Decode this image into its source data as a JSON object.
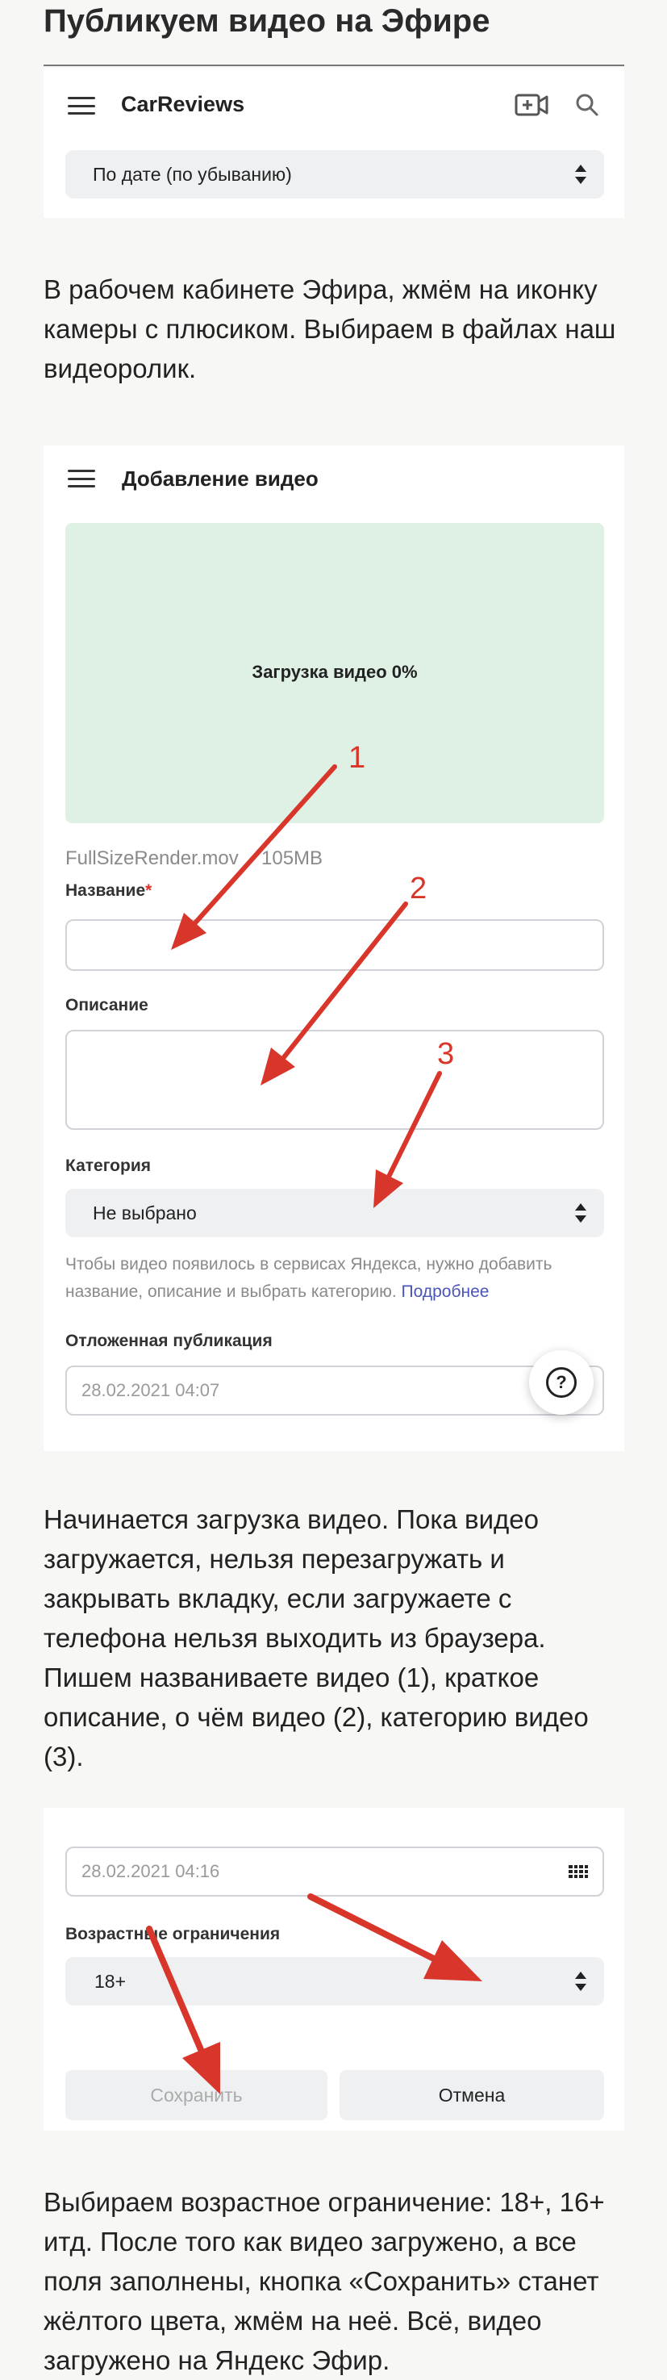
{
  "heading": "Публикуем видео на Эфире",
  "screen1": {
    "channel_name": "CarReviews",
    "sort_select": "По дате (по убыванию)",
    "icons": [
      "menu-icon",
      "add-video-camera-icon",
      "search-icon"
    ]
  },
  "paragraph1": "В рабочем кабинете Эфира, жмём на иконку камеры с плюсиком. Выбираем в файлах наш видеоролик.",
  "screen2": {
    "title": "Добавление видео",
    "upload_status": "Загрузка видео 0%",
    "file_name": "FullSizeRender.mov",
    "file_size": "105MB",
    "name_label": "Название",
    "required_mark": "*",
    "name_value": "",
    "description_label": "Описание",
    "description_value": "",
    "category_label": "Категория",
    "category_value": "Не выбрано",
    "hint_text": "Чтобы видео появилось в сервисах Яндекса, нужно добавить название, описание и выбрать категорию.",
    "hint_link": "Подробнее",
    "delayed_label": "Отложенная публикация",
    "delayed_value": "28.02.2021 04:07",
    "help_button": "?",
    "annotations": [
      "1",
      "2",
      "3"
    ],
    "upload_area_color": "#dff0e4"
  },
  "paragraph2": "Начинается загрузка видео. Пока видео загружается, нельзя перезагружать и закрывать вкладку, если загружаете с телефона нельзя выходить из браузера. Пишем названиваете видео (1), краткое описание, о чём видео (2), категорию видео (3).",
  "screen3": {
    "delayed_value": "28.02.2021 04:16",
    "age_label": "Возрастные ограничения",
    "age_value": "18+",
    "save_button": "Сохранить",
    "cancel_button": "Отмена"
  },
  "paragraph3": "Выбираем возрастное ограничение: 18+, 16+ итд. После того как видео загружено, а все поля заполнены, кнопка «Сохранить» станет жёлтого цвета, жмём на неё. Всё, видео загружено на Яндекс Эфир.",
  "colors": {
    "arrow_red": "#d9362b",
    "link_blue": "#4a55b8",
    "page_bg": "#f7f7f5"
  }
}
